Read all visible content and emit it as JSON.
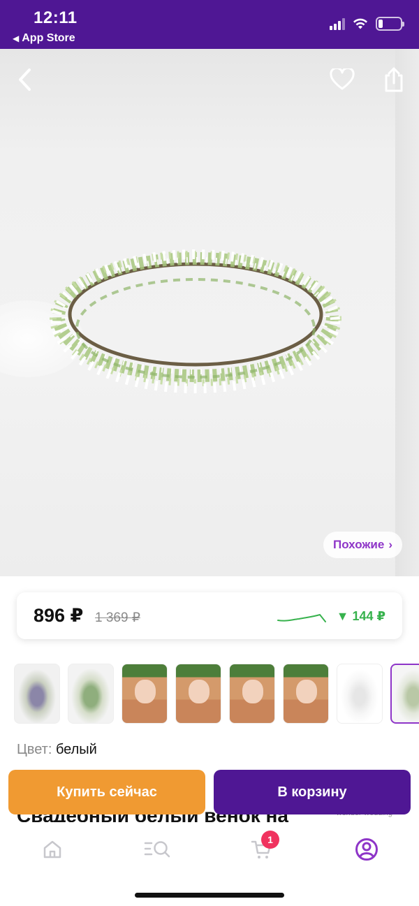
{
  "status_bar": {
    "time": "12:11",
    "back_label": "App Store",
    "back_glyph": "◀"
  },
  "hero": {
    "similar_label": "Похожие",
    "similar_chevron": "›"
  },
  "price": {
    "current": "896 ₽",
    "old": "1 369 ₽",
    "drop": "▼ 144 ₽"
  },
  "color": {
    "label": "Цвет:",
    "value": "белый"
  },
  "product": {
    "title_partial": "Свадебный белый венок на",
    "watermark": "wonder-wedding"
  },
  "actions": {
    "buy_now": "Купить сейчас",
    "add_to_cart": "В корзину"
  },
  "tabbar": {
    "cart_badge": "1"
  },
  "colors": {
    "brand": "#4f1794",
    "accent_purple": "#8e35c8",
    "buy_orange": "#f09a32",
    "price_drop_green": "#37b24d",
    "badge_red": "#f0335f"
  },
  "icons": [
    "back-chevron-icon",
    "heart-icon",
    "share-icon",
    "home-icon",
    "catalog-search-icon",
    "cart-icon",
    "profile-icon"
  ]
}
